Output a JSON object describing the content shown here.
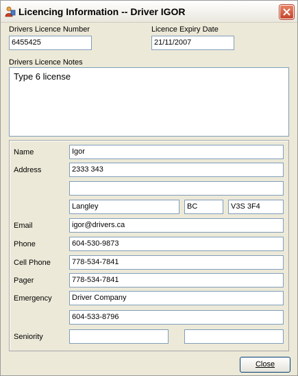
{
  "window": {
    "title": "Licencing Information -- Driver IGOR"
  },
  "licence": {
    "number_label": "Drivers Licence Number",
    "number_value": "6455425",
    "expiry_label": "Licence Expiry Date",
    "expiry_value": "21/11/2007",
    "notes_label": "Drivers Licence Notes",
    "notes_value": "Type 6 license"
  },
  "details": {
    "name_label": "Name",
    "name_value": "Igor",
    "address_label": "Address",
    "address_line1": "2333 343",
    "address_line2": "",
    "city": "Langley",
    "province": "BC",
    "postal": "V3S 3F4",
    "email_label": "Email",
    "email_value": "igor@drivers.ca",
    "phone_label": "Phone",
    "phone_value": "604-530-9873",
    "cell_label": "Cell Phone",
    "cell_value": "778-534-7841",
    "pager_label": "Pager",
    "pager_value": "778-534-7841",
    "emergency_label": "Emergency",
    "emergency_name": "Driver Company",
    "emergency_phone": "604-533-8796",
    "seniority_label": "Seniority",
    "seniority_value1": "",
    "seniority_value2": ""
  },
  "buttons": {
    "close_label": "Close"
  },
  "icons": {
    "title_icon": "driver-person-icon",
    "close_icon": "close-x-icon"
  }
}
